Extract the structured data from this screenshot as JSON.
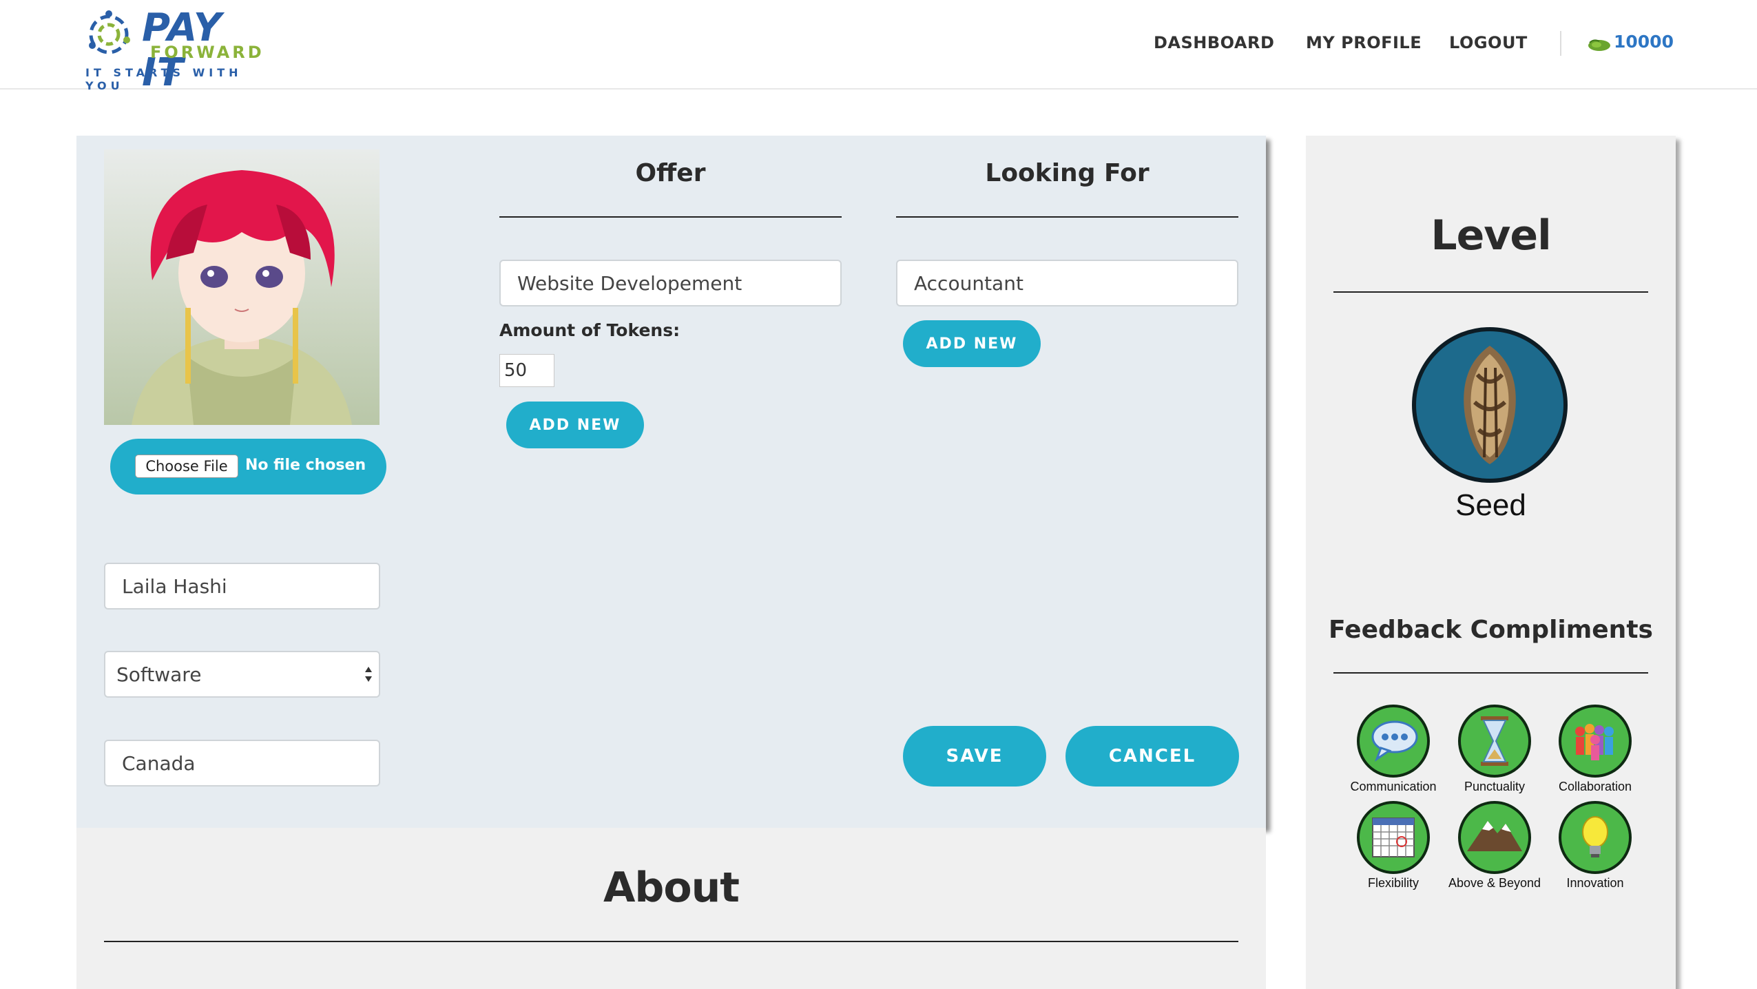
{
  "header": {
    "logo": {
      "line1": "PAY IT",
      "line2": "FORWARD",
      "tagline": "IT STARTS WITH YOU"
    },
    "nav": [
      {
        "label": "DASHBOARD"
      },
      {
        "label": "MY PROFILE"
      },
      {
        "label": "LOGOUT"
      }
    ],
    "tokens": {
      "icon": "seed-pod-icon",
      "count": "10000"
    }
  },
  "profile": {
    "avatar_alt": "profile-photo",
    "file_input": {
      "button_label": "Choose File",
      "status": "No file chosen"
    },
    "name": "Laila Hashi",
    "category": {
      "selected": "Software"
    },
    "country": "Canada"
  },
  "offer": {
    "title": "Offer",
    "skill": "Website Developement",
    "tokens_label": "Amount of Tokens:",
    "tokens_value": "50",
    "add_label": "ADD NEW"
  },
  "looking_for": {
    "title": "Looking For",
    "skill": "Accountant",
    "add_label": "ADD NEW"
  },
  "actions": {
    "save_label": "SAVE",
    "cancel_label": "CANCEL"
  },
  "about": {
    "title": "About"
  },
  "level": {
    "title": "Level",
    "name": "Seed",
    "icon": "seed-icon"
  },
  "feedback": {
    "title": "Feedback Compliments",
    "badges": [
      {
        "label": "Communication",
        "icon": "speech-bubble-icon"
      },
      {
        "label": "Punctuality",
        "icon": "hourglass-icon"
      },
      {
        "label": "Collaboration",
        "icon": "people-group-icon"
      },
      {
        "label": "Flexibility",
        "icon": "calendar-icon"
      },
      {
        "label": "Above & Beyond",
        "icon": "mountain-icon"
      },
      {
        "label": "Innovation",
        "icon": "lightbulb-icon"
      }
    ]
  },
  "colors": {
    "accent": "#21aecb",
    "card_bg": "#e6ecf1",
    "side_bg": "#f0f0f0",
    "badge_green": "#4cb849",
    "level_blue": "#1d6a8c"
  }
}
